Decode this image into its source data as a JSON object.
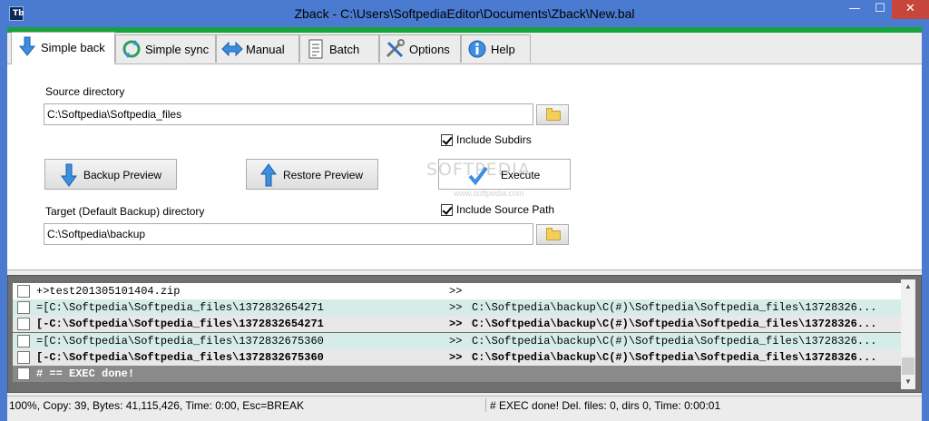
{
  "window": {
    "title": "Zback - C:\\Users\\SoftpediaEditor\\Documents\\Zback\\New.bal",
    "app_icon_text": "Tb",
    "controls": {
      "minimize": "—",
      "maximize": "☐",
      "close": "✕"
    }
  },
  "tabs": [
    {
      "label": "Simple back",
      "icon": "arrow-down-icon",
      "active": true
    },
    {
      "label": "Simple sync",
      "icon": "sync-icon",
      "active": false
    },
    {
      "label": "Manual",
      "icon": "double-arrow-icon",
      "active": false
    },
    {
      "label": "Batch",
      "icon": "document-icon",
      "active": false
    },
    {
      "label": "Options",
      "icon": "tools-icon",
      "active": false
    },
    {
      "label": "Help",
      "icon": "info-icon",
      "active": false
    }
  ],
  "form": {
    "source_label": "Source directory",
    "source_value": "C:\\Softpedia\\Softpedia_files",
    "include_subdirs": {
      "label": "Include Subdirs",
      "checked": true
    },
    "backup_preview": "Backup Preview",
    "restore_preview": "Restore Preview",
    "execute": "Execute",
    "target_label": "Target (Default Backup) directory",
    "target_value": "C:\\Softpedia\\backup",
    "include_source_path": {
      "label": "Include Source Path",
      "checked": true
    }
  },
  "watermark": {
    "brand": "SOFTPEDIA",
    "url": "www.softpedia.com"
  },
  "log": [
    {
      "left": "+>test201305101404.zip",
      "arrow": ">>",
      "right": "",
      "bg": "#ffffff",
      "bold": false,
      "color": "#000000"
    },
    {
      "left": "=[C:\\Softpedia\\Softpedia_files\\1372832654271",
      "arrow": ">>",
      "right": "C:\\Softpedia\\backup\\C(#)\\Softpedia\\Softpedia_files\\13728326...",
      "bg": "#d6ece8",
      "bold": false,
      "color": "#000000"
    },
    {
      "left": "[-C:\\Softpedia\\Softpedia_files\\1372832654271",
      "arrow": ">>",
      "right": "C:\\Softpedia\\backup\\C(#)\\Softpedia\\Softpedia_files\\13728326...",
      "bg": "#e8e8e8",
      "bold": true,
      "color": "#000000"
    },
    {
      "left": "=[C:\\Softpedia\\Softpedia_files\\1372832675360",
      "arrow": ">>",
      "right": "C:\\Softpedia\\backup\\C(#)\\Softpedia\\Softpedia_files\\13728326...",
      "bg": "#d6ece8",
      "bold": false,
      "color": "#000000"
    },
    {
      "left": "[-C:\\Softpedia\\Softpedia_files\\1372832675360",
      "arrow": ">>",
      "right": "C:\\Softpedia\\backup\\C(#)\\Softpedia\\Softpedia_files\\13728326...",
      "bg": "#e8e8e8",
      "bold": true,
      "color": "#000000"
    },
    {
      "left": "# == EXEC done!",
      "arrow": "",
      "right": "",
      "bg": "#8a8a8a",
      "bold": true,
      "color": "#ffffff"
    }
  ],
  "status": {
    "left": "100%, Copy: 39, Bytes: 41,115,426, Time: 0:00, Esc=BREAK",
    "right": "# EXEC done! Del. files: 0,  dirs 0,  Time: 0:00:01"
  },
  "colors": {
    "title_bar": "#4a7bd0",
    "accent_green": "#16a33b",
    "close_red": "#c7463c"
  }
}
